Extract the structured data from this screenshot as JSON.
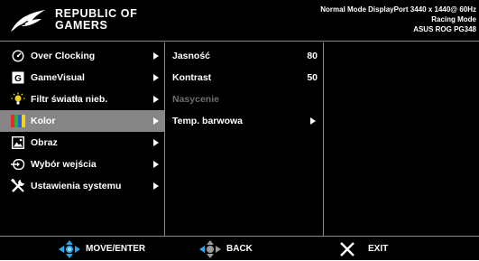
{
  "header": {
    "brand_line1": "REPUBLIC OF",
    "brand_line2": "GAMERS",
    "logo_icon": "rog-eye-logo-icon",
    "status_line1": "Normal Mode DisplayPort 3440 x 1440@ 60Hz",
    "status_line2": "Racing Mode",
    "status_line3": "ASUS ROG PG348"
  },
  "main_menu": {
    "items": [
      {
        "label": "Over Clocking",
        "icon": "speedometer-icon"
      },
      {
        "label": "GameVisual",
        "icon": "gamevisual-g-icon"
      },
      {
        "label": "Filtr światła nieb.",
        "icon": "bulb-icon"
      },
      {
        "label": "Kolor",
        "icon": "color-bars-icon"
      },
      {
        "label": "Obraz",
        "icon": "picture-icon"
      },
      {
        "label": "Wybór wejścia",
        "icon": "input-icon"
      },
      {
        "label": "Ustawienia systemu",
        "icon": "tools-icon"
      }
    ],
    "selected_index": 3
  },
  "sub_menu": {
    "items": [
      {
        "label": "Jasność",
        "value": "80"
      },
      {
        "label": "Kontrast",
        "value": "50"
      },
      {
        "label": "Nasycenie",
        "value": ""
      },
      {
        "label": "Temp. barwowa",
        "value": ""
      }
    ]
  },
  "footer": {
    "move_label": "MOVE/ENTER",
    "back_label": "BACK",
    "exit_label": "EXIT"
  },
  "colors": {
    "background": "#000000",
    "selected_row": "#868686",
    "divider": "#8a8a8a",
    "disabled_text": "#6e6e6e",
    "joystick_blue": "#2aa5e8",
    "exit_x": "#ffffff"
  }
}
